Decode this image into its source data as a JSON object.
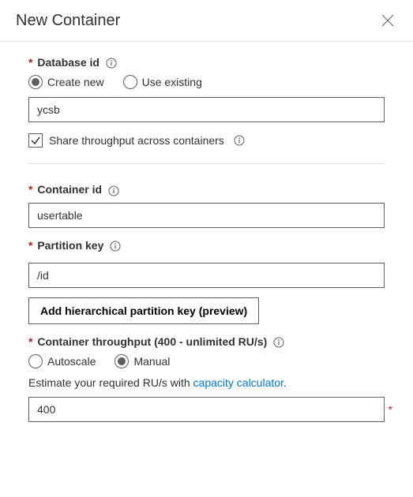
{
  "header": {
    "title": "New Container"
  },
  "database": {
    "label": "Database id",
    "radio_new": "Create new",
    "radio_existing": "Use existing",
    "value": "ycsb",
    "share_label": "Share throughput across containers"
  },
  "container": {
    "label": "Container id",
    "value": "usertable"
  },
  "partition": {
    "label": "Partition key",
    "value": "/id",
    "hierarchical_btn": "Add hierarchical partition key (preview)"
  },
  "throughput": {
    "label": "Container throughput (400 - unlimited RU/s)",
    "radio_auto": "Autoscale",
    "radio_manual": "Manual",
    "estimate_prefix": "Estimate your required RU/s with ",
    "estimate_link": "capacity calculator",
    "estimate_suffix": ".",
    "value": "400"
  }
}
